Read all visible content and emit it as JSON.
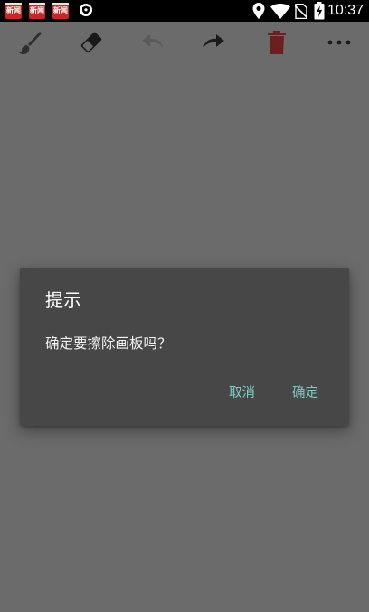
{
  "status_bar": {
    "notification_icons": [
      "news-app-icon",
      "news-app-icon",
      "news-app-icon",
      "shield-icon"
    ],
    "notification_badge_text": "新闻",
    "status_icons": [
      "location-icon",
      "wifi-icon",
      "no-sim-icon",
      "battery-charging-icon"
    ],
    "time": "10:37"
  },
  "toolbar": {
    "tools": [
      {
        "name": "brush-icon",
        "color": "#2e2e2e"
      },
      {
        "name": "eraser-icon",
        "color": "#1a1a1a"
      },
      {
        "name": "undo-icon",
        "color": "#5a5a5a"
      },
      {
        "name": "redo-icon",
        "color": "#1a1a1a"
      },
      {
        "name": "delete-icon",
        "color": "#6b1f1f"
      },
      {
        "name": "more-icon",
        "color": "#1a1a1a"
      }
    ]
  },
  "dialog": {
    "title": "提示",
    "message": "确定要擦除画板吗？",
    "cancel_label": "取消",
    "confirm_label": "确定",
    "accent_color": "#80cbc4"
  }
}
